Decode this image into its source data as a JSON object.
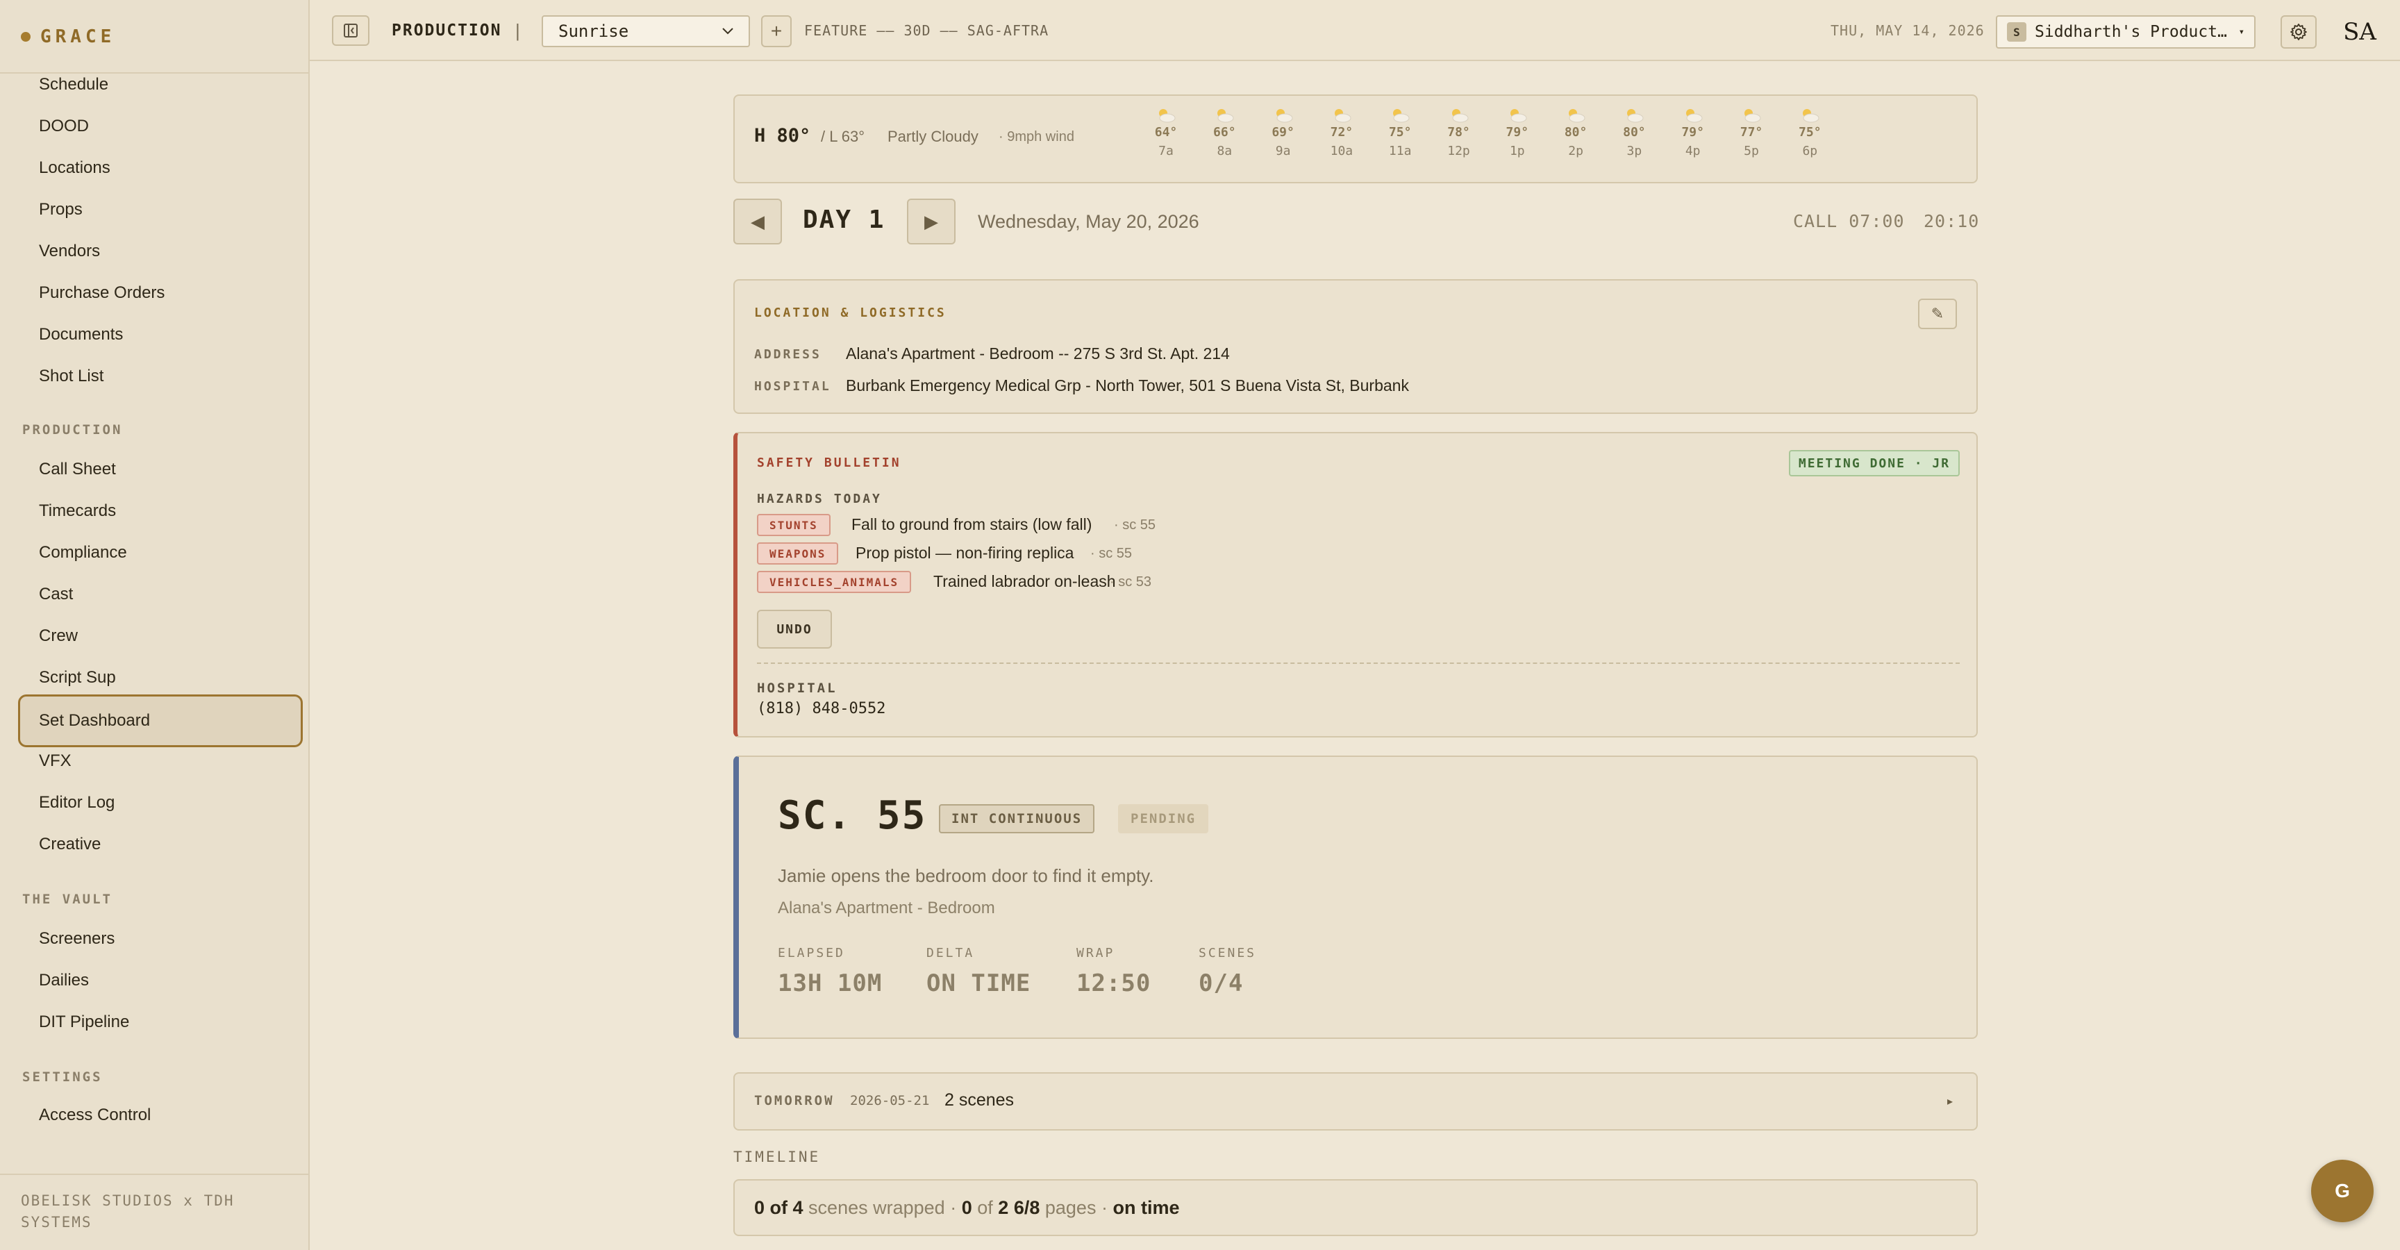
{
  "sidebar": {
    "brand": "GRACE",
    "items_top": [
      "Schedule",
      "DOOD",
      "Locations",
      "Props",
      "Vendors",
      "Purchase Orders",
      "Documents",
      "Shot List"
    ],
    "production_header": "PRODUCTION",
    "items_production": [
      "Call Sheet",
      "Timecards",
      "Compliance",
      "Cast",
      "Crew",
      "Script Sup",
      "Set Dashboard",
      "VFX",
      "Editor Log",
      "Creative"
    ],
    "active_item": "Set Dashboard",
    "vault_header": "THE VAULT",
    "items_vault": [
      "Screeners",
      "Dailies",
      "DIT Pipeline"
    ],
    "settings_header": "SETTINGS",
    "items_settings": [
      "Access Control"
    ],
    "footer": "OBELISK STUDIOS x TDH SYSTEMS"
  },
  "topbar": {
    "production_label": "PRODUCTION",
    "separator": "|",
    "production_select": "Sunrise",
    "add_label": "+",
    "meta": "FEATURE —— 30D —— SAG-AFTRA",
    "date": "THU, MAY 14, 2026",
    "org_badge": "S",
    "org_name": "Siddharth's Production Co.",
    "avatar": "SA"
  },
  "weather": {
    "high": "H 80°",
    "low": "/ L 63°",
    "condition": "Partly Cloudy",
    "wind": "· 9mph wind",
    "hours": [
      {
        "temp": "64°",
        "time": "7a"
      },
      {
        "temp": "66°",
        "time": "8a"
      },
      {
        "temp": "69°",
        "time": "9a"
      },
      {
        "temp": "72°",
        "time": "10a"
      },
      {
        "temp": "75°",
        "time": "11a"
      },
      {
        "temp": "78°",
        "time": "12p"
      },
      {
        "temp": "79°",
        "time": "1p"
      },
      {
        "temp": "80°",
        "time": "2p"
      },
      {
        "temp": "80°",
        "time": "3p"
      },
      {
        "temp": "79°",
        "time": "4p"
      },
      {
        "temp": "77°",
        "time": "5p"
      },
      {
        "temp": "75°",
        "time": "6p"
      }
    ]
  },
  "day": {
    "label": "DAY 1",
    "date": "Wednesday, May 20, 2026",
    "call": "CALL 07:00",
    "wrap": "20:10",
    "prev_glyph": "◀",
    "next_glyph": "▶"
  },
  "location": {
    "title": "LOCATION & LOGISTICS",
    "edit_glyph": "✎",
    "address_key": "ADDRESS",
    "address_val": "Alana's Apartment - Bedroom -- 275 S 3rd St. Apt. 214",
    "hospital_key": "HOSPITAL",
    "hospital_val": "Burbank Emergency Medical Grp - North Tower, 501 S Buena Vista St, Burbank"
  },
  "safety": {
    "title": "SAFETY BULLETIN",
    "badge": "MEETING DONE · JR",
    "hazards_header": "HAZARDS TODAY",
    "hazards": [
      {
        "tag": "STUNTS",
        "desc": "Fall to ground from stairs (low fall)",
        "scene": "·  sc 55"
      },
      {
        "tag": "WEAPONS",
        "desc": "Prop pistol — non-firing replica",
        "scene": "·  sc 55"
      },
      {
        "tag": "VEHICLES_ANIMALS",
        "desc": "Trained labrador on-leash",
        "scene": "·  sc 53"
      }
    ],
    "undo": "UNDO",
    "hospital_label": "HOSPITAL",
    "hospital_phone": "(818) 848-0552"
  },
  "scene": {
    "title": "SC. 55",
    "tag_int": "INT CONTINUOUS",
    "tag_status": "PENDING",
    "description": "Jamie opens the bedroom door to find it empty.",
    "location": "Alana's Apartment - Bedroom",
    "stats": [
      {
        "key": "ELAPSED",
        "value": "13H 10M"
      },
      {
        "key": "DELTA",
        "value": "ON TIME"
      },
      {
        "key": "WRAP",
        "value": "12:50"
      },
      {
        "key": "SCENES",
        "value": "0/4"
      }
    ]
  },
  "tomorrow": {
    "label": "TOMORROW",
    "date": "2026-05-21",
    "count": "2 scenes",
    "caret": "▸"
  },
  "timeline": {
    "label": "TIMELINE",
    "scenes_done": "0 of 4",
    "scenes_word": "scenes wrapped",
    "sep1": "·",
    "pages_done": "0",
    "of_word": "of",
    "pages_total": "2 6/8",
    "pages_word": "pages",
    "sep2": "·",
    "status": "on time"
  },
  "fab": "G",
  "colors": {
    "accent": "#9c7530",
    "danger": "#b6523c",
    "scene_bar": "#5a6f99",
    "ok": "#3f6b34"
  }
}
